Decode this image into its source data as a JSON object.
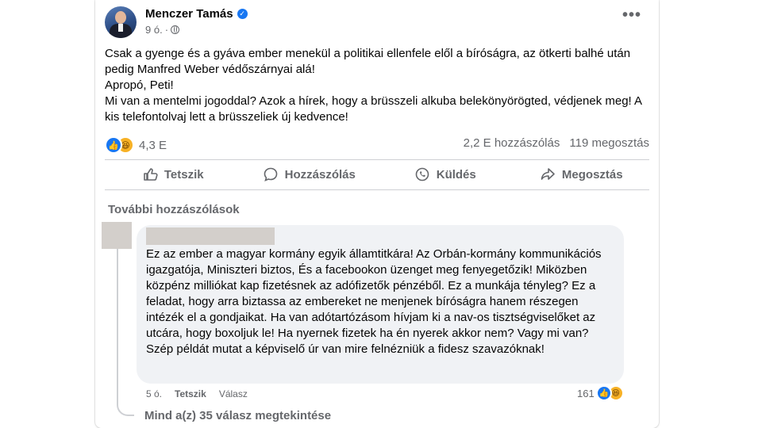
{
  "post": {
    "author": "Menczer Tamás",
    "time": "9 ó.",
    "separator": "·",
    "text": [
      "Csak a gyenge és a gyáva ember menekül a politikai ellenfele elől a bíróságra, az ötkerti balhé után pedig Manfred Weber védőszárnyai alá!",
      "Apropó, Peti!",
      "Mi van a mentelmi jogoddal? Azok a hírek, hogy a brüsszeli alkuba belekönyörögted, védjenek meg! A kis telefontolvaj lett a brüsszeliek új kedvence!"
    ],
    "reaction_count": "4,3 E",
    "comment_count": "2,2 E hozzászólás",
    "share_count": "119 megosztás",
    "reactions": [
      "like-icon",
      "haha-icon"
    ]
  },
  "actions": {
    "like": "Tetszik",
    "comment": "Hozzászólás",
    "send": "Küldés",
    "share": "Megosztás"
  },
  "comments": {
    "more_label": "További hozzászólások",
    "first": {
      "text": "Ez az ember a magyar kormány egyik államtitkára! Az Orbán-kormány kommunikációs igazgatója, Miniszteri biztos, És a facebookon üzenget meg fenyegetőzik! Miközben közpénz milliókat kap fizetésnek az adófizetők pénzéből. Ez a munkája tényleg? Ez a feladat, hogy arra biztassa az embereket ne menjenek bíróságra hanem részegen intézék el a gondjaikat. Ha van adótartózásom hívjam ki a nav-os tisztségviselőket az utcára, hogy boxoljuk le! Ha nyernek fizetek ha én nyerek akkor nem? Vagy mi van? Szép példát mutat a képviselő úr van mire felnézniük a fidesz szavazóknak!",
      "time": "5 ó.",
      "like_label": "Tetszik",
      "reply_label": "Válasz",
      "reaction_count": "161"
    },
    "view_replies": "Mind a(z) 35 válasz megtekintése"
  },
  "colors": {
    "accent": "#1877f2",
    "secondary_text": "#65676b",
    "bubble": "#f0f2f5"
  }
}
